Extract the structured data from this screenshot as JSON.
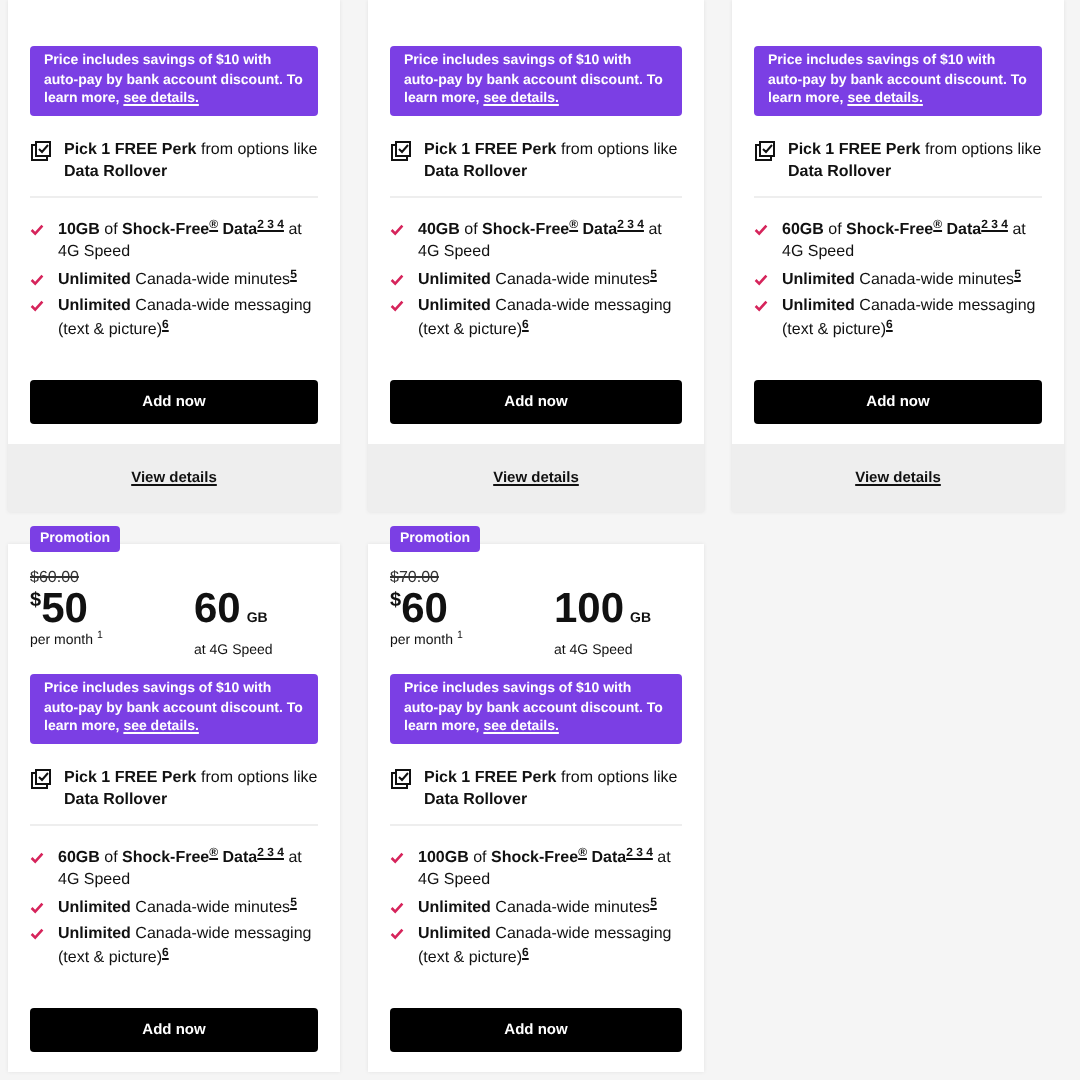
{
  "plans": [
    {
      "note": "Price includes savings of $10 with auto-pay by bank account discount. To learn more,",
      "note_link": "see details.",
      "perk": "**Pick 1 FREE Perk** from options like **Data Rollover**",
      "features": [
        "**10GB** of **Shock-Free**$^{®}$ **Data**$^{2 3 4}$ at 4G Speed",
        "**Unlimited** Canada-wide minutes$^{5}$",
        "**Unlimited** Canada-wide messaging (text & picture)$^{6}$"
      ],
      "button": "Add now",
      "details": "View details"
    },
    {
      "note": "Price includes savings of $10 with auto-pay by bank account discount. To learn more,",
      "note_link": "see details.",
      "perk": "**Pick 1 FREE Perk** from options like **Data Rollover**",
      "features": [
        "**40GB** of **Shock-Free**$^{®}$ **Data**$^{2 3 4}$ at 4G Speed",
        "**Unlimited** Canada-wide minutes$^{5}$",
        "**Unlimited** Canada-wide messaging (text & picture)$^{6}$"
      ],
      "button": "Add now",
      "details": "View details"
    },
    {
      "note": "Price includes savings of $10 with auto-pay by bank account discount. To learn more,",
      "note_link": "see details.",
      "perk": "**Pick 1 FREE Perk** from options like **Data Rollover**",
      "features": [
        "**60GB** of **Shock-Free**$^{®}$ **Data**$^{2 3 4}$ at 4G Speed",
        "**Unlimited** Canada-wide minutes$^{5}$",
        "**Unlimited** Canada-wide messaging (text & picture)$^{6}$"
      ],
      "button": "Add now",
      "details": "View details"
    },
    {
      "badge": "Promotion",
      "old_price": "$60.00",
      "currency": "$",
      "price": "50",
      "per_month": "per month",
      "footnote": "1",
      "data_amount": "60",
      "data_unit": "GB",
      "speed": "at 4G Speed",
      "note": "Price includes savings of $10 with auto-pay by bank account discount. To learn more,",
      "note_link": "see details.",
      "perk": "**Pick 1 FREE Perk** from options like **Data Rollover**",
      "features": [
        "**60GB** of **Shock-Free**$^{®}$ **Data**$^{2 3 4}$ at 4G Speed",
        "**Unlimited** Canada-wide minutes$^{5}$",
        "**Unlimited** Canada-wide messaging (text & picture)$^{6}$"
      ],
      "button": "Add now"
    },
    {
      "badge": "Promotion",
      "old_price": "$70.00",
      "currency": "$",
      "price": "60",
      "per_month": "per month",
      "footnote": "1",
      "data_amount": "100",
      "data_unit": "GB",
      "speed": "at 4G Speed",
      "note": "Price includes savings of $10 with auto-pay by bank account discount. To learn more,",
      "note_link": "see details.",
      "perk": "**Pick 1 FREE Perk** from options like **Data Rollover**",
      "features": [
        "**100GB** of **Shock-Free**$^{®}$ **Data**$^{2 3 4}$ at 4G Speed",
        "**Unlimited** Canada-wide minutes$^{5}$",
        "**Unlimited** Canada-wide messaging (text & picture)$^{6}$"
      ],
      "button": "Add now"
    }
  ]
}
